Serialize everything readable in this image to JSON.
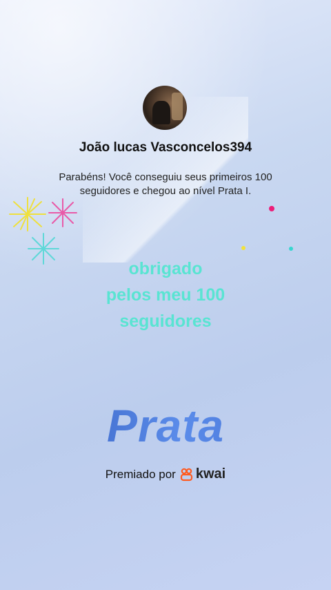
{
  "profile": {
    "username": "João lucas Vasconcelos394",
    "message": "Parabéns! Você conseguiu seus primeiros 100 seguidores e chegou ao nível Prata I."
  },
  "thanks_lines": [
    "obrigado",
    "pelos meu 100",
    "seguidores"
  ],
  "level": "Prata",
  "award": {
    "label": "Premiado por",
    "brand": "kwai",
    "brand_icon": "kwai-logo-icon"
  },
  "colors": {
    "thanks_text": "#59e4d2",
    "level_text": "#3f6fd1",
    "brand_orange": "#ff5a1f",
    "confetti_pink": "#ec1e79",
    "confetti_yellow": "#f2e23a",
    "confetti_cyan": "#36d6cf"
  }
}
